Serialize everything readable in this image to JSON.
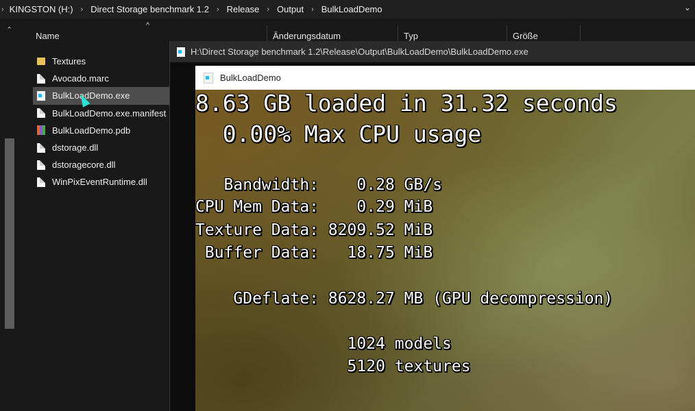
{
  "explorer": {
    "breadcrumbs": [
      "KINGSTON (H:)",
      "Direct Storage benchmark 1.2",
      "Release",
      "Output",
      "BulkLoadDemo"
    ],
    "columns": [
      "Name",
      "Änderungsdatum",
      "Typ",
      "Größe"
    ],
    "files": [
      {
        "name": "Textures",
        "icon": "folder-icon"
      },
      {
        "name": "Avocado.marc",
        "icon": "file-icon"
      },
      {
        "name": "BulkLoadDemo.exe",
        "icon": "exe-icon",
        "selected": true
      },
      {
        "name": "BulkLoadDemo.exe.manifest",
        "icon": "file-icon"
      },
      {
        "name": "BulkLoadDemo.pdb",
        "icon": "pdb-icon"
      },
      {
        "name": "dstorage.dll",
        "icon": "file-icon"
      },
      {
        "name": "dstoragecore.dll",
        "icon": "file-icon"
      },
      {
        "name": "WinPixEventRuntime.dll",
        "icon": "file-icon"
      }
    ]
  },
  "console": {
    "title": "H:\\Direct Storage benchmark 1.2\\Release\\Output\\BulkLoadDemo\\BulkLoadDemo.exe"
  },
  "app": {
    "title": "BulkLoadDemo",
    "lines": [
      "8.63 GB loaded in 31.32 seconds",
      "  0.00% Max CPU usage",
      "   Bandwidth:    0.28 GB/s",
      "CPU Mem Data:    0.29 MiB",
      "Texture Data: 8209.52 MiB",
      " Buffer Data:   18.75 MiB",
      "    GDeflate: 8628.27 MB (GPU decompression)",
      "                1024 models",
      "                5120 textures"
    ]
  }
}
